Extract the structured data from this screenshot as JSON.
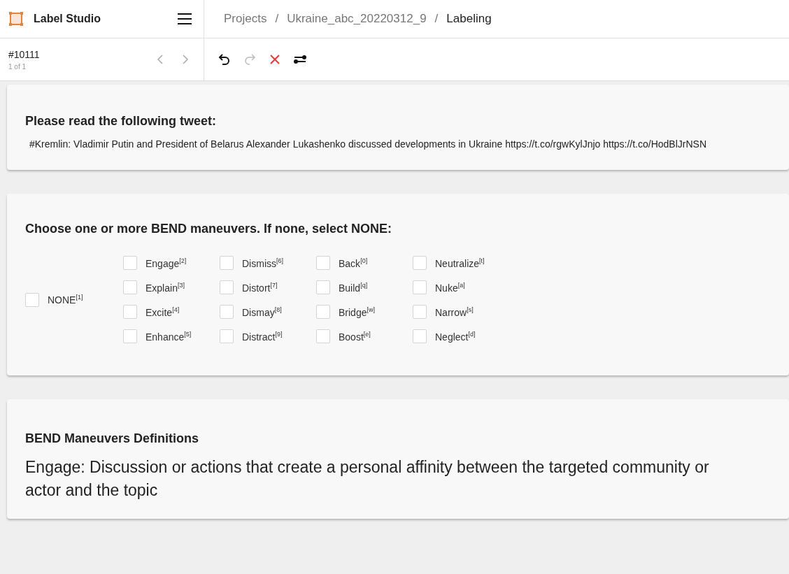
{
  "app": {
    "name": "Label Studio"
  },
  "breadcrumbs": [
    "Projects",
    "/",
    "Ukraine_abc_20220312_9",
    "/",
    "Labeling"
  ],
  "task": {
    "id": "#10111",
    "position": "1 of 1"
  },
  "toolbar": [
    {
      "kind": "undo",
      "disabled": false
    },
    {
      "kind": "redo",
      "disabled": true
    },
    {
      "kind": "reset",
      "disabled": false
    },
    {
      "kind": "swap",
      "disabled": false
    }
  ],
  "tweet_card": {
    "heading": "Please read the following tweet:",
    "text": "#Kremlin: Vladimir Putin and President of Belarus Alexander Lukashenko discussed developments in Ukraine https://t.co/rgwKylJnjo https://t.co/HodBlJrNSN"
  },
  "choices_card": {
    "heading": "Choose one or more BEND maneuvers. If none, select NONE:",
    "none_option": {
      "label": "NONE$^{[1]}$",
      "checked": false
    },
    "columns": [
      [
        {
          "label": "Engage$^{[2]}$",
          "checked": false
        },
        {
          "label": "Explain$^{[3]}$",
          "checked": false
        },
        {
          "label": "Excite$^{[4]}$",
          "checked": false
        },
        {
          "label": "Enhance$^{[5]}$",
          "checked": false
        }
      ],
      [
        {
          "label": "Dismiss$^{[6]}$",
          "checked": false
        },
        {
          "label": "Distort$^{[7]}$",
          "checked": false
        },
        {
          "label": "Dismay$^{[8]}$",
          "checked": false
        },
        {
          "label": "Distract$^{[9]}$",
          "checked": false
        }
      ],
      [
        {
          "label": "Back$^{[0]}$",
          "checked": false
        },
        {
          "label": "Build$^{[q]}$",
          "checked": false
        },
        {
          "label": "Bridge$^{[w]}$",
          "checked": false
        },
        {
          "label": "Boost$^{[e]}$",
          "checked": false
        }
      ],
      [
        {
          "label": "Neutralize$^{[t]}$",
          "checked": false
        },
        {
          "label": "Nuke$^{[a]}$",
          "checked": false
        },
        {
          "label": "Narrow$^{[s]}$",
          "checked": false
        },
        {
          "label": "Neglect$^{[d]}$",
          "checked": false
        }
      ]
    ]
  },
  "definitions_card": {
    "heading": "BEND Maneuvers Definitions",
    "definition": "Engage: Discussion or actions that create a personal affinity between the targeted community or actor and the topic"
  }
}
